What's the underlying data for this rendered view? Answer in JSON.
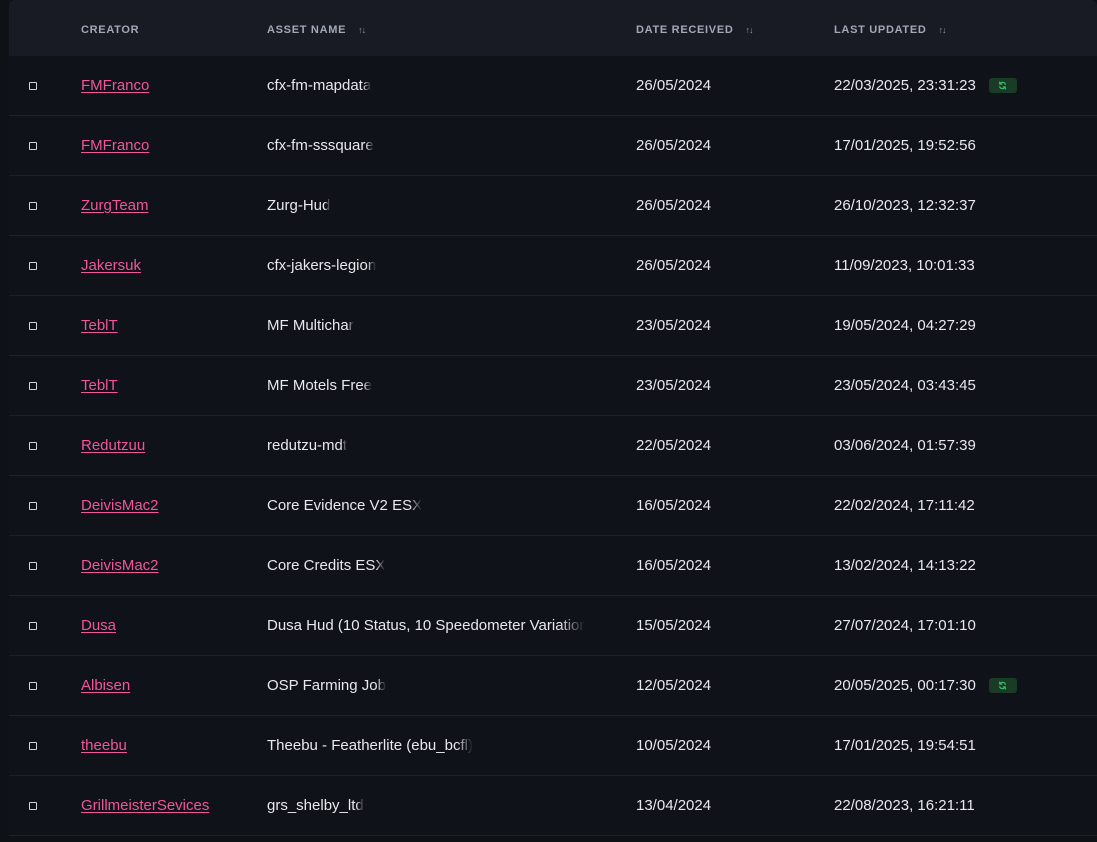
{
  "table": {
    "headers": {
      "creator": "CREATOR",
      "asset_name": "ASSET NAME",
      "date_received": "DATE RECEIVED",
      "last_updated": "LAST UPDATED"
    },
    "sort_icon": "sort-arrows-icon",
    "update_icon": "refresh-icon",
    "colors": {
      "creator_link": "#f0569a",
      "update_badge_bg": "#1a3b26",
      "update_badge_icon": "#35c26a",
      "header_bg": "#181b23",
      "row_bg": "#0f1218"
    },
    "rows": [
      {
        "creator": "FMFranco",
        "asset": "cfx-fm-mapdata",
        "received": "26/05/2024",
        "updated": "22/03/2025, 23:31:23",
        "has_update": true
      },
      {
        "creator": "FMFranco",
        "asset": "cfx-fm-sssquare",
        "received": "26/05/2024",
        "updated": "17/01/2025, 19:52:56",
        "has_update": false
      },
      {
        "creator": "ZurgTeam",
        "asset": "Zurg-Hud",
        "received": "26/05/2024",
        "updated": "26/10/2023, 12:32:37",
        "has_update": false
      },
      {
        "creator": "Jakersuk",
        "asset": "cfx-jakers-legion",
        "received": "26/05/2024",
        "updated": "11/09/2023, 10:01:33",
        "has_update": false
      },
      {
        "creator": "TeblT",
        "asset": "MF Multichar",
        "received": "23/05/2024",
        "updated": "19/05/2024, 04:27:29",
        "has_update": false
      },
      {
        "creator": "TeblT",
        "asset": "MF Motels Free",
        "received": "23/05/2024",
        "updated": "23/05/2024, 03:43:45",
        "has_update": false
      },
      {
        "creator": "Redutzuu",
        "asset": "redutzu-mdt",
        "received": "22/05/2024",
        "updated": "03/06/2024, 01:57:39",
        "has_update": false
      },
      {
        "creator": "DeivisMac2",
        "asset": "Core Evidence V2 ESX",
        "received": "16/05/2024",
        "updated": "22/02/2024, 17:11:42",
        "has_update": false
      },
      {
        "creator": "DeivisMac2",
        "asset": "Core Credits ESX",
        "received": "16/05/2024",
        "updated": "13/02/2024, 14:13:22",
        "has_update": false
      },
      {
        "creator": "Dusa",
        "asset": "Dusa Hud (10 Status, 10 Speedometer Variation",
        "received": "15/05/2024",
        "updated": "27/07/2024, 17:01:10",
        "has_update": false
      },
      {
        "creator": "Albisen",
        "asset": "OSP Farming Job",
        "received": "12/05/2024",
        "updated": "20/05/2025, 00:17:30",
        "has_update": true
      },
      {
        "creator": "theebu",
        "asset": "Theebu - Featherlite (ebu_bcfl)",
        "received": "10/05/2024",
        "updated": "17/01/2025, 19:54:51",
        "has_update": false
      },
      {
        "creator": "GrillmeisterSevices",
        "asset": "grs_shelby_ltd",
        "received": "13/04/2024",
        "updated": "22/08/2023, 16:21:11",
        "has_update": false
      }
    ]
  }
}
